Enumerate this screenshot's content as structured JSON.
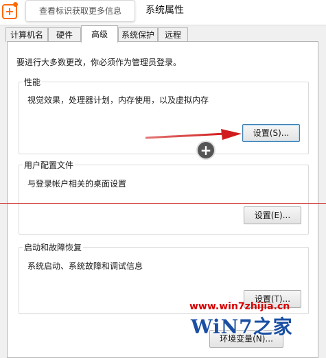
{
  "tooltip": {
    "text": "查看标识获取更多信息"
  },
  "window": {
    "title": "系统属性"
  },
  "tabs": [
    {
      "label": "计算机名"
    },
    {
      "label": "硬件"
    },
    {
      "label": "高级"
    },
    {
      "label": "系统保护"
    },
    {
      "label": "远程"
    }
  ],
  "admin_note": "要进行大多数更改，你必须作为管理员登录。",
  "performance": {
    "label": "性能",
    "description": "视觉效果，处理器计划，内存使用，以及虚拟内存",
    "button": "设置(S)..."
  },
  "user_profiles": {
    "label": "用户配置文件",
    "description": "与登录帐户相关的桌面设置",
    "button": "设置(E)..."
  },
  "startup_recovery": {
    "label": "启动和故障恢复",
    "description": "系统启动、系统故障和调试信息",
    "button": "设置(T)..."
  },
  "env_button": "环境变量(N)...",
  "watermark": {
    "url": "www.win7zhijia.cn",
    "text": "WiN7之家"
  },
  "colors": {
    "arrow": "#d01c1c",
    "accent_focus": "#3c7fb1",
    "watermark_red": "#d60000",
    "watermark_blue": "#1a4fa3"
  }
}
